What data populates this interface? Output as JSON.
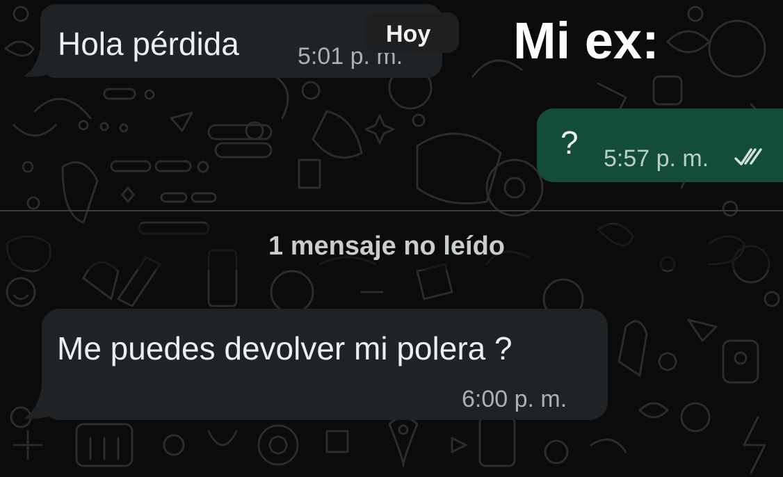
{
  "caption": "Mi ex:",
  "date_chip": "Hoy",
  "unread_divider": "1 mensaje no leído",
  "messages": [
    {
      "direction": "incoming",
      "text": "Hola pérdida",
      "time": "5:01 p. m."
    },
    {
      "direction": "outgoing",
      "text": "?",
      "time": "5:57 p. m.",
      "status": "double-check-icon"
    },
    {
      "direction": "incoming",
      "text": "Me puedes devolver mi polera ?",
      "time": "6:00 p. m."
    }
  ],
  "colors": {
    "background": "#0b0b0b",
    "incoming_bubble": "#1f2326",
    "outgoing_bubble": "#144d37",
    "timestamp": "#a9b1b5",
    "read_ticks": "#cfe3da"
  }
}
